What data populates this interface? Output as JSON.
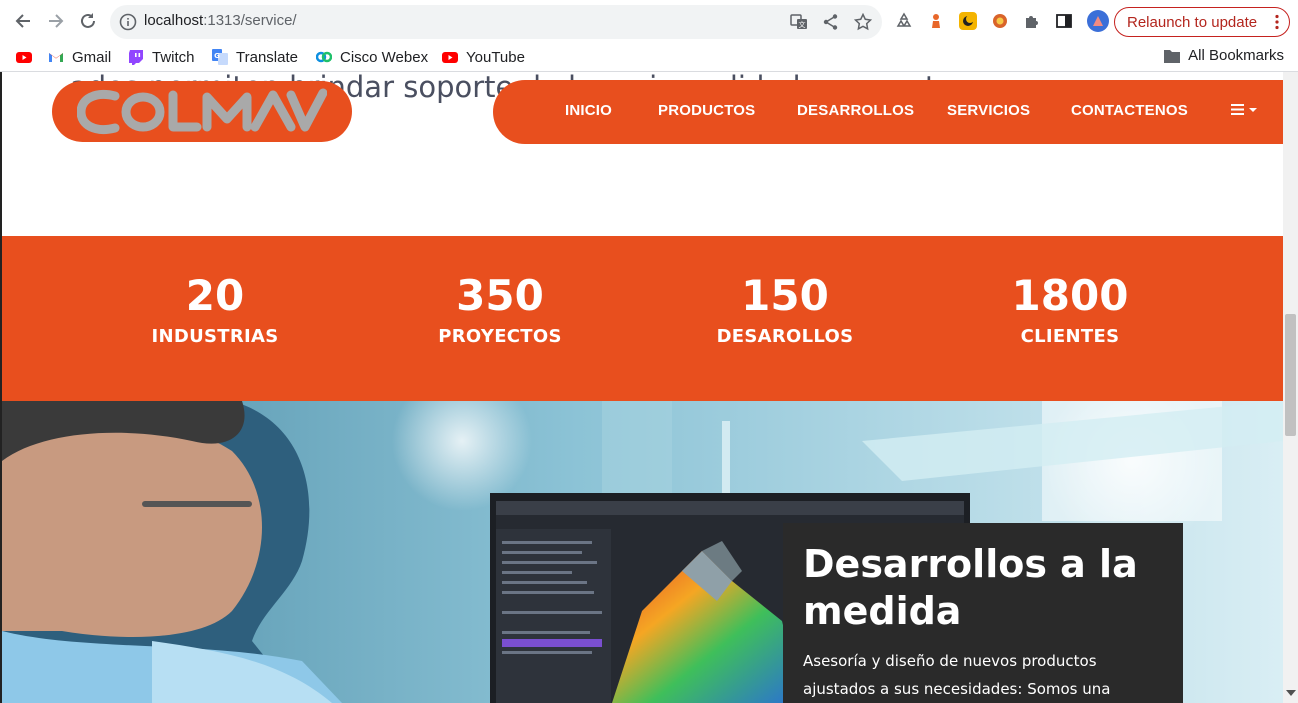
{
  "browser": {
    "url_host": "localhost",
    "url_path": ":1313/service/",
    "relaunch_label": "Relaunch to update",
    "bookmarks": [
      "Gmail",
      "Twitch",
      "Translate",
      "Cisco Webex",
      "YouTube"
    ],
    "all_bookmarks_label": "All Bookmarks"
  },
  "page": {
    "behind_text": "ades permiten brindar soporte de la mejor calidad en nuestro",
    "logo_text": "COLMAV",
    "nav": {
      "items": [
        "INICIO",
        "PRODUCTOS",
        "DESARROLLOS",
        "SERVICIOS",
        "CONTACTENOS"
      ],
      "menu_icon": "hamburger-caret-icon"
    },
    "stats": [
      {
        "number": "20",
        "label": "INDUSTRIAS"
      },
      {
        "number": "350",
        "label": "PROYECTOS"
      },
      {
        "number": "150",
        "label": "DESAROLLOS"
      },
      {
        "number": "1800",
        "label": "CLIENTES"
      }
    ],
    "card": {
      "title": "Desarrollos a la medida",
      "text": "Asesoría y diseño de nuevos productos ajustados a sus necesidades: Somos una"
    }
  },
  "colors": {
    "brand_orange": "#e84f1e",
    "card_dark": "#2a2a2a"
  }
}
